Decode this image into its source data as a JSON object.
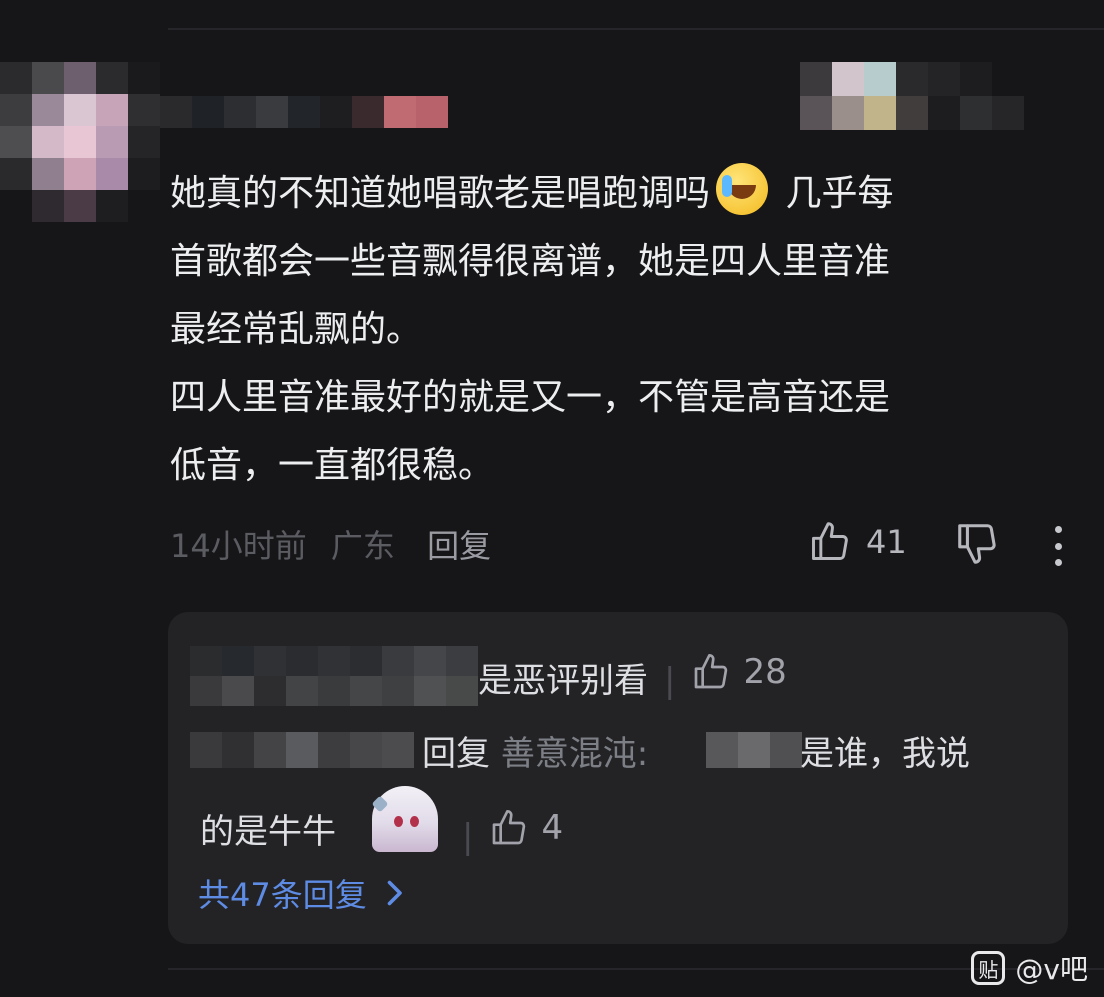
{
  "comment": {
    "text_before_emoji": "她真的不知道她唱歌老是唱跑调吗",
    "emoji": "laughing-crying-face",
    "text_after_emoji": " 几乎每\n首歌都会一些音飘得很离谱，她是四人里音准\n最经常乱飘的。\n四人里音准最好的就是又一，不管是高音还是\n低音，一直都很稳。",
    "time": "14小时前",
    "location": "广东",
    "reply_label": "回复",
    "like_count": "41"
  },
  "replies": {
    "first": {
      "text": "是恶评别看",
      "like_count": "28"
    },
    "second": {
      "reply_word": "回复",
      "target_name": "善意混沌:",
      "text_part1": "是谁，我说",
      "text_part2": "的是牛牛",
      "like_count": "4"
    },
    "more_label": "共47条回复"
  },
  "watermark": {
    "logo_text": "贴",
    "handle": "@v吧"
  },
  "colors": {
    "background": "#161618",
    "panel": "#232326",
    "link": "#5e8be3",
    "muted": "#5b5c62"
  },
  "mosaics": {
    "avatar": [
      "#2b2b2d",
      "#4a4a4d",
      "#6e5f6e",
      "#2b2b2d",
      "#1a1a1c",
      "#3d3d40",
      "#9a8a99",
      "#d9c6d2",
      "#c7a4b8",
      "#2f2f31",
      "#4e4e51",
      "#d4b9c8",
      "#e9c6d4",
      "#b99cb4",
      "#252527",
      "#2a2a2c",
      "#8f7f8f",
      "#cfa3b6",
      "#a98aa8",
      "#1d1d1f",
      "#161618",
      "#2f2a2f",
      "#4a3b46",
      "#1e1e20",
      "#161618"
    ],
    "username": [
      "#2a2a2c",
      "#1f2226",
      "#2c2e31",
      "#3a3b3e",
      "#22262a",
      "#1e1e21",
      "#3a2a2e",
      "#c06a72",
      "#b8636b"
    ],
    "badge": [
      "#3c3a3d",
      "#d2c5cc",
      "#b7cccc",
      "#2a2a2c",
      "#242426",
      "#1d1d1f",
      "#161618",
      "#161618",
      "#5a5458",
      "#9b8f8c",
      "#c2b48a",
      "#403d3c",
      "#1d1d1f",
      "#2e2f31",
      "#262628",
      "#161618"
    ],
    "reply1_user": [
      "#2b2c2e",
      "#262a2e",
      "#2f3135",
      "#2a2c30",
      "#303236",
      "#2c2d30",
      "#3a3b3e",
      "#454649",
      "#3c3d40",
      "#3a3a3c",
      "#4a4a4c",
      "#2d2d30",
      "#434446",
      "#3a3b3d",
      "#454648",
      "#3f4042",
      "#505153",
      "#484949"
    ],
    "reply2_user": [
      "#3a3a3d",
      "#303032",
      "#444446",
      "#5a5b5e",
      "#3d3d40",
      "#474749",
      "#4c4c4e"
    ],
    "inline_mask": [
      "#58585b",
      "#6a6a6d",
      "#505053"
    ]
  }
}
